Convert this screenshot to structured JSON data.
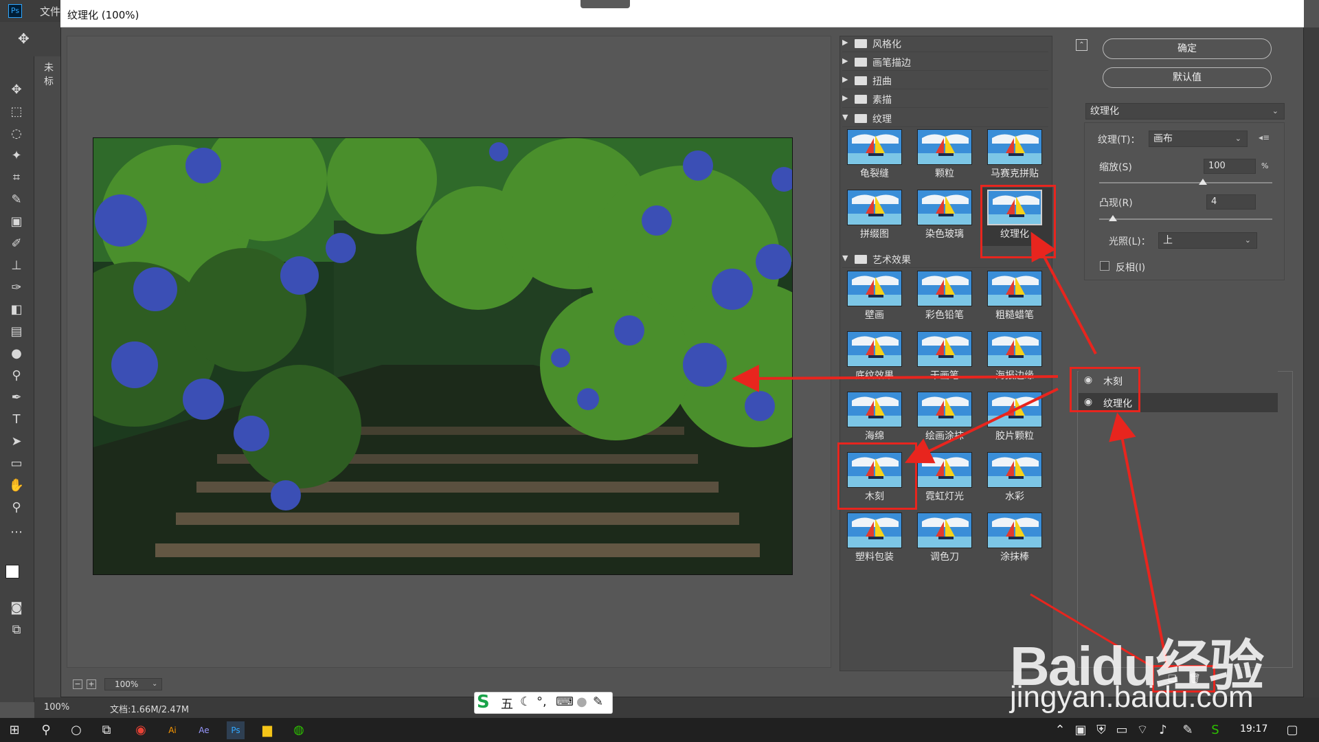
{
  "app": {
    "logo_text": "Ps",
    "menu_file": "文件",
    "doc_tab_partial": "未标",
    "status": {
      "zoom": "100%",
      "doc_info": "文档:1.66M/2.47M"
    }
  },
  "dialog": {
    "title": "纹理化 (100%)",
    "zoom_select": "100%",
    "filter_categories": [
      {
        "label": "风格化",
        "expanded": false
      },
      {
        "label": "画笔描边",
        "expanded": false
      },
      {
        "label": "扭曲",
        "expanded": false
      },
      {
        "label": "素描",
        "expanded": false
      },
      {
        "label": "纹理",
        "expanded": true
      },
      {
        "label": "艺术效果",
        "expanded": true
      }
    ],
    "texture_filters": [
      "龟裂缝",
      "颗粒",
      "马赛克拼贴",
      "拼缀图",
      "染色玻璃",
      "纹理化"
    ],
    "artistic_filters": [
      "壁画",
      "彩色铅笔",
      "粗糙蜡笔",
      "底纹效果",
      "干画笔",
      "海报边缘",
      "海绵",
      "绘画涂抹",
      "胶片颗粒",
      "木刻",
      "霓虹灯光",
      "水彩",
      "塑料包装",
      "调色刀",
      "涂抹棒"
    ],
    "selected_filter": "纹理化",
    "buttons": {
      "ok": "确定",
      "default": "默认值"
    },
    "filter_select": "纹理化",
    "options": {
      "texture_label": "纹理(T)：",
      "texture_value": "画布",
      "scale_label": "缩放(S)",
      "scale_value": "100",
      "scale_unit": "%",
      "scale_level": 0.6,
      "relief_label": "凸现(R)",
      "relief_value": "4",
      "relief_level": 0.08,
      "light_label": "光照(L)：",
      "light_value": "上",
      "invert_label": "反相(I)",
      "invert_checked": false
    },
    "effect_layers": [
      "木刻",
      "纹理化"
    ]
  },
  "ime": {
    "mode": "五",
    "logo": "S"
  },
  "taskbar": {
    "time": "19:17"
  },
  "watermark": {
    "logo": "Baidu经验",
    "url": "jingyan.baidu.com"
  },
  "colors": {
    "annotation_red": "#e8251e",
    "ps_blue": "#31a8ff"
  }
}
